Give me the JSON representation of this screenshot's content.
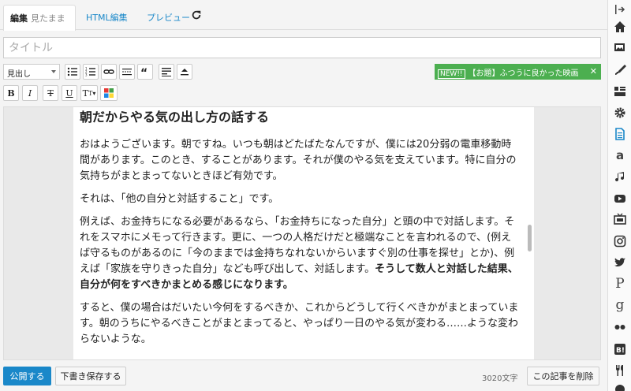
{
  "tabs": {
    "edit_label": "編集",
    "edit_sub": "見たまま",
    "html_label": "HTML編集",
    "preview_label": "プレビュー"
  },
  "title_field": {
    "placeholder": "タイトル",
    "value": ""
  },
  "toolbar": {
    "heading_select": "見出し",
    "bold": "B",
    "italic": "I",
    "strike": "T",
    "underline": "U",
    "fontsize": "T"
  },
  "topic_banner": {
    "badge": "NEW!!",
    "text": "【お題】ふつうに良かった映画"
  },
  "article": {
    "heading": "朝だからやる気の出し方の話する",
    "p1": "おはようございます。朝ですね。いつも朝はどたばたなんですが、僕には20分弱の電車移動時間があります。このとき、することがあります。それが僕のやる気を支えています。特に自分の気持ちがまとまってないときほど有効です。",
    "p2": "それは、「他の自分と対話すること」です。",
    "p3": "例えば、お金持ちになる必要があるなら、「お金持ちになった自分」と頭の中で対話します。それをスマホにメモって行きます。更に、一つの人格だけだと極端なことを言われるので、(例えば守るものがあるのに「今のままでは金持ちなれないからいますぐ別の仕事を探せ」とか)、例えば「家族を守りきった自分」なども呼び出して、対話します。",
    "p3_bold": "そうして数人と対話した結果、自分が何をすべきかまとめる感じになります。",
    "p4": "すると、僕の場合はだいたい今何をするべきか、これからどうして行くべきかがまとまっています。朝のうちにやるべきことがまとまってると、やっぱり一日のやる気が変わる……ような変わらないような。"
  },
  "footer": {
    "publish": "公開する",
    "save_draft": "下書き保存する",
    "char_count": "3020文字",
    "delete": "この記事を削除"
  },
  "sidebar_icons": [
    "collapse-icon",
    "home-icon",
    "photo-icon",
    "brush-icon",
    "layout-icon",
    "gear-icon",
    "document-icon",
    "amazon-icon",
    "music-icon",
    "youtube-icon",
    "tv-icon",
    "instagram-icon",
    "twitter-icon",
    "pixiv-icon",
    "google-icon",
    "flickr-icon",
    "hatena-bookmark-icon",
    "restaurant-icon",
    "more-icon"
  ],
  "colors": {
    "accent": "#1a88c9",
    "topic": "#4caf50"
  }
}
